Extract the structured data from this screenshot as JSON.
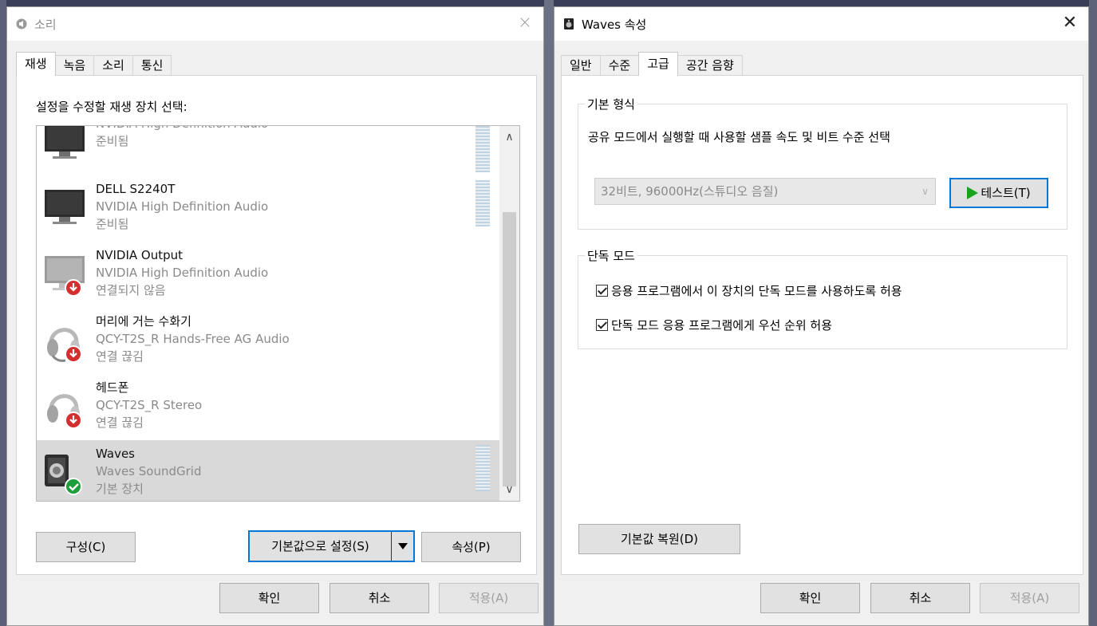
{
  "sound_window": {
    "title": "소리",
    "close_glyph": "×",
    "tabs": [
      "재생",
      "녹음",
      "소리",
      "통신"
    ],
    "caption": "설정을 수정할 재생 장치 선택:",
    "devices": [
      {
        "name": "",
        "desc": "NVIDIA High Definition Audio",
        "status": "준비됨",
        "icon": "monitor-icon"
      },
      {
        "name": "DELL S2240T",
        "desc": "NVIDIA High Definition Audio",
        "status": "준비됨",
        "icon": "monitor-icon"
      },
      {
        "name": "NVIDIA Output",
        "desc": "NVIDIA High Definition Audio",
        "status": "연결되지 않음",
        "icon": "monitor-disconnected-icon"
      },
      {
        "name": "머리에 거는 수화기",
        "desc": "QCY-T2S_R Hands-Free AG Audio",
        "status": "연결 끊김",
        "icon": "headset-disconnected-icon"
      },
      {
        "name": "헤드폰",
        "desc": "QCY-T2S_R Stereo",
        "status": "연결 끊김",
        "icon": "headphones-disconnected-icon"
      },
      {
        "name": "Waves",
        "desc": "Waves SoundGrid",
        "status": "기본 장치",
        "icon": "speaker-default-icon"
      }
    ],
    "configure_label": "구성(C)",
    "set_default_label": "기본값으로 설정(S)",
    "properties_label": "속성(P)",
    "ok_label": "확인",
    "cancel_label": "취소",
    "apply_label": "적용(A)"
  },
  "props_window": {
    "title": "Waves 속성",
    "close_glyph": "✕",
    "tabs": [
      "일반",
      "수준",
      "고급",
      "공간 음향"
    ],
    "default_format": {
      "legend": "기본 형식",
      "description": "공유 모드에서 실행할 때 사용할 샘플 속도 및 비트 수준 선택",
      "selected_format": "32비트, 96000Hz(스튜디오 음질)",
      "test_label": "테스트(T)"
    },
    "exclusive_mode": {
      "legend": "단독 모드",
      "option1": "응용 프로그램에서 이 장치의 단독 모드를 사용하도록 허용",
      "option1_checked": true,
      "option2": "단독 모드 응용 프로그램에게 우선 순위 허용",
      "option2_checked": true
    },
    "restore_defaults_label": "기본값 복원(D)",
    "ok_label": "확인",
    "cancel_label": "취소",
    "apply_label": "적용(A)"
  },
  "colors": {
    "accent": "#0078d7",
    "selection": "#d9d9d9",
    "disconnect_badge": "#d32f2f",
    "default_badge": "#1e9e3a"
  }
}
